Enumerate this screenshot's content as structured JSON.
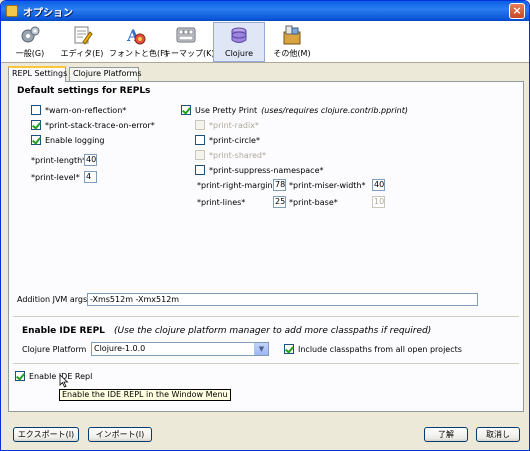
{
  "window": {
    "title": "オプション",
    "close": "×"
  },
  "toolbar": {
    "items": [
      {
        "label": "一般(G)",
        "icon": "general-settings-icon"
      },
      {
        "label": "エディタ(E)",
        "icon": "editor-icon"
      },
      {
        "label": "フォントと色(F)",
        "icon": "fonts-colors-icon"
      },
      {
        "label": "キーマップ(K)",
        "icon": "keymap-icon"
      },
      {
        "label": "Clojure",
        "icon": "clojure-icon",
        "selected": true
      },
      {
        "label": "その他(M)",
        "icon": "miscellaneous-icon"
      }
    ]
  },
  "tabs": [
    {
      "label": "REPL Settings",
      "active": true
    },
    {
      "label": "Clojure Platforms",
      "active": false
    }
  ],
  "repl": {
    "title": "Default settings for REPLs",
    "warn_reflection": {
      "label": "*warn-on-reflection*",
      "checked": false
    },
    "print_stack_trace": {
      "label": "*print-stack-trace-on-error*",
      "checked": true
    },
    "enable_logging": {
      "label": "Enable logging",
      "checked": true
    },
    "print_length": {
      "label": "*print-length*",
      "value": "40"
    },
    "print_level": {
      "label": "*print-level*",
      "value": "4"
    },
    "pretty_print": {
      "label": "Use Pretty Print",
      "note": "(uses/requires clojure.contrib.pprint)",
      "checked": true
    },
    "print_radix": {
      "label": "*print-radix*",
      "checked": false,
      "disabled": true
    },
    "print_circle": {
      "label": "*print-circle*",
      "checked": false
    },
    "print_shared": {
      "label": "*print-shared*",
      "checked": false,
      "disabled": true
    },
    "print_suppress_namespace": {
      "label": "*print-suppress-namespace*",
      "checked": false
    },
    "print_right_margin": {
      "label": "*print-right-margin*",
      "value": "78"
    },
    "print_miser_width": {
      "label": "*print-miser-width*",
      "value": "40"
    },
    "print_lines": {
      "label": "*print-lines*",
      "value": "25"
    },
    "print_base": {
      "label": "*print-base*",
      "value": "10",
      "disabled": true
    },
    "jvm_args": {
      "label": "Addition JVM args:",
      "value": "-Xms512m -Xmx512m"
    }
  },
  "ide_repl": {
    "title": "Enable IDE REPL",
    "note": "(Use the clojure platform manager to add more classpaths if required)",
    "platform_label": "Clojure Platform",
    "platform_value": "Clojure-1.0.0",
    "include_classpaths": {
      "label": "Include classpaths from all open projects",
      "checked": true
    },
    "enable": {
      "label": "Enable IDE Repl",
      "checked": true
    },
    "tooltip": "Enable the IDE REPL in the Window Menu"
  },
  "buttons": {
    "export": "エクスポート(I)",
    "import": "インポート(I)",
    "ok": "了解",
    "cancel": "取消し"
  },
  "colors": {
    "title_bar": "#0a5fe4",
    "panel": "#ece9d8",
    "check": "#21a121",
    "tab_highlight": "#ffc83c"
  }
}
